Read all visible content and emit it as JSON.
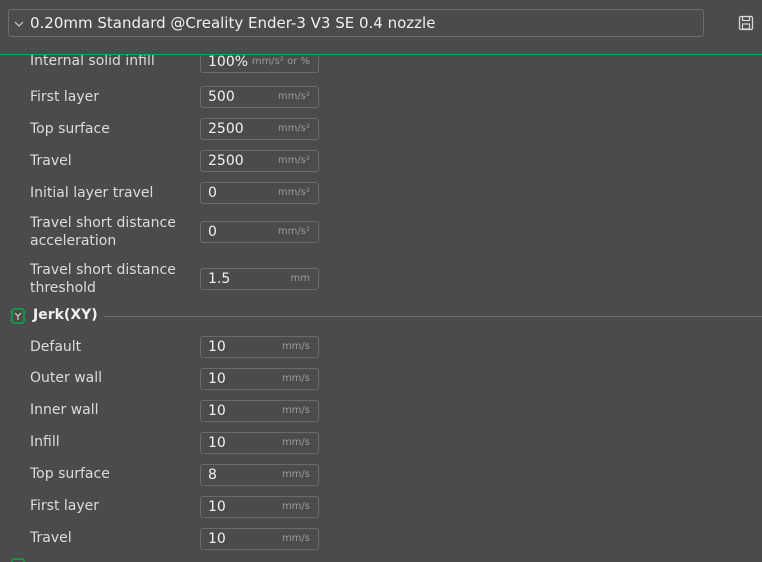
{
  "preset": {
    "label": "0.20mm Standard @Creality Ender-3 V3 SE 0.4 nozzle"
  },
  "accel_rows": [
    {
      "label": "Internal solid infill",
      "value": "100%",
      "unit": "mm/s² or %"
    },
    {
      "label": "First layer",
      "value": "500",
      "unit": "mm/s²"
    },
    {
      "label": "Top surface",
      "value": "2500",
      "unit": "mm/s²"
    },
    {
      "label": "Travel",
      "value": "2500",
      "unit": "mm/s²"
    },
    {
      "label": "Initial layer travel",
      "value": "0",
      "unit": "mm/s²"
    },
    {
      "label": "Travel short distance acceleration",
      "value": "0",
      "unit": "mm/s²"
    },
    {
      "label": "Travel short distance threshold",
      "value": "1.5",
      "unit": "mm"
    }
  ],
  "jerk_section": {
    "title": "Jerk(XY)"
  },
  "jerk_rows": [
    {
      "label": "Default",
      "value": "10",
      "unit": "mm/s"
    },
    {
      "label": "Outer wall",
      "value": "10",
      "unit": "mm/s"
    },
    {
      "label": "Inner wall",
      "value": "10",
      "unit": "mm/s"
    },
    {
      "label": "Infill",
      "value": "10",
      "unit": "mm/s"
    },
    {
      "label": "Top surface",
      "value": "8",
      "unit": "mm/s"
    },
    {
      "label": "First layer",
      "value": "10",
      "unit": "mm/s"
    },
    {
      "label": "Travel",
      "value": "10",
      "unit": "mm/s"
    }
  ],
  "icons": {
    "preset_dropdown": "chevron-down-icon",
    "save": "save-icon",
    "jerk": "jerk-section-icon",
    "next_section": "section-icon"
  },
  "colors": {
    "accent": "#00ae42",
    "background": "#4b4b4d",
    "border": "#6b6b6d"
  }
}
